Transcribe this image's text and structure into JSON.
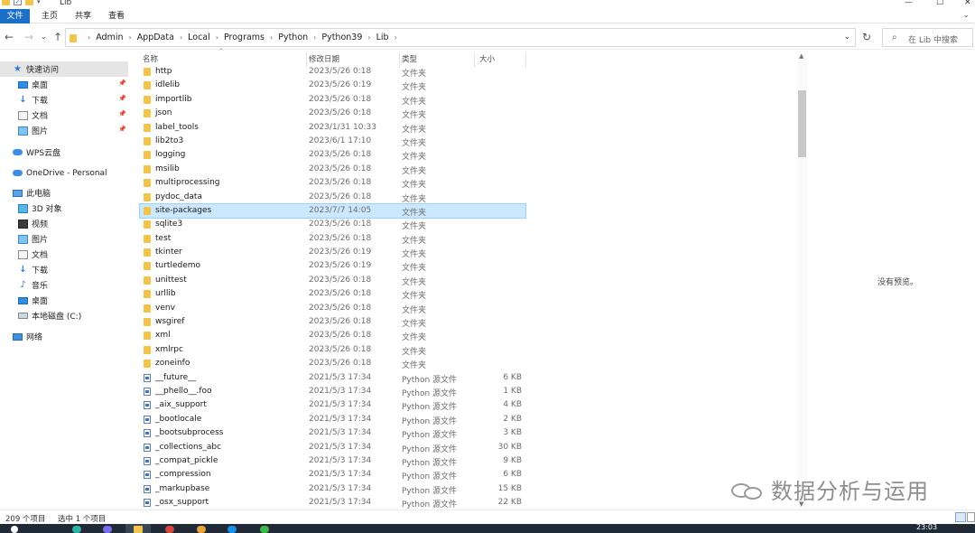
{
  "window": {
    "title": "Lib",
    "controls": [
      "—",
      "☐",
      "✕"
    ]
  },
  "ribbon": {
    "tabs": [
      "文件",
      "主页",
      "共享",
      "查看"
    ]
  },
  "address": {
    "crumbs": [
      "Admin",
      "AppData",
      "Local",
      "Programs",
      "Python",
      "Python39",
      "Lib"
    ],
    "search_placeholder": "在 Lib 中搜索"
  },
  "nav": {
    "items": [
      {
        "label": "快速访问",
        "icon": "star-icon",
        "selected": true
      },
      {
        "label": "桌面",
        "icon": "desktop-icon",
        "pinned": true
      },
      {
        "label": "下载",
        "icon": "download-icon",
        "pinned": true
      },
      {
        "label": "文档",
        "icon": "document-icon",
        "pinned": true
      },
      {
        "label": "图片",
        "icon": "picture-icon",
        "pinned": true
      },
      {
        "label": "WPS云盘",
        "icon": "cloud-icon"
      },
      {
        "label": "OneDrive - Personal",
        "icon": "cloud-icon"
      },
      {
        "label": "此电脑",
        "icon": "computer-icon"
      },
      {
        "label": "3D 对象",
        "icon": "3d-objects-icon"
      },
      {
        "label": "视频",
        "icon": "video-icon"
      },
      {
        "label": "图片",
        "icon": "picture-icon"
      },
      {
        "label": "文档",
        "icon": "document-icon"
      },
      {
        "label": "下载",
        "icon": "download-icon"
      },
      {
        "label": "音乐",
        "icon": "music-icon"
      },
      {
        "label": "桌面",
        "icon": "desktop-icon"
      },
      {
        "label": "本地磁盘 (C:)",
        "icon": "drive-icon"
      },
      {
        "label": "网络",
        "icon": "network-icon"
      }
    ]
  },
  "columns": {
    "name": "名称",
    "date": "修改日期",
    "type": "类型",
    "size": "大小"
  },
  "files": [
    {
      "name": "http",
      "date": "2023/5/26 0:18",
      "type": "文件夹",
      "size": "",
      "kind": "folder"
    },
    {
      "name": "idlelib",
      "date": "2023/5/26 0:19",
      "type": "文件夹",
      "size": "",
      "kind": "folder"
    },
    {
      "name": "importlib",
      "date": "2023/5/26 0:18",
      "type": "文件夹",
      "size": "",
      "kind": "folder"
    },
    {
      "name": "json",
      "date": "2023/5/26 0:18",
      "type": "文件夹",
      "size": "",
      "kind": "folder"
    },
    {
      "name": "label_tools",
      "date": "2023/1/31 10:33",
      "type": "文件夹",
      "size": "",
      "kind": "folder"
    },
    {
      "name": "lib2to3",
      "date": "2023/6/1 17:10",
      "type": "文件夹",
      "size": "",
      "kind": "folder"
    },
    {
      "name": "logging",
      "date": "2023/5/26 0:18",
      "type": "文件夹",
      "size": "",
      "kind": "folder"
    },
    {
      "name": "msilib",
      "date": "2023/5/26 0:18",
      "type": "文件夹",
      "size": "",
      "kind": "folder"
    },
    {
      "name": "multiprocessing",
      "date": "2023/5/26 0:18",
      "type": "文件夹",
      "size": "",
      "kind": "folder"
    },
    {
      "name": "pydoc_data",
      "date": "2023/5/26 0:18",
      "type": "文件夹",
      "size": "",
      "kind": "folder"
    },
    {
      "name": "site-packages",
      "date": "2023/7/7 14:05",
      "type": "文件夹",
      "size": "",
      "kind": "folder",
      "selected": true
    },
    {
      "name": "sqlite3",
      "date": "2023/5/26 0:18",
      "type": "文件夹",
      "size": "",
      "kind": "folder"
    },
    {
      "name": "test",
      "date": "2023/5/26 0:18",
      "type": "文件夹",
      "size": "",
      "kind": "folder"
    },
    {
      "name": "tkinter",
      "date": "2023/5/26 0:19",
      "type": "文件夹",
      "size": "",
      "kind": "folder"
    },
    {
      "name": "turtledemo",
      "date": "2023/5/26 0:19",
      "type": "文件夹",
      "size": "",
      "kind": "folder"
    },
    {
      "name": "unittest",
      "date": "2023/5/26 0:18",
      "type": "文件夹",
      "size": "",
      "kind": "folder"
    },
    {
      "name": "urllib",
      "date": "2023/5/26 0:18",
      "type": "文件夹",
      "size": "",
      "kind": "folder"
    },
    {
      "name": "venv",
      "date": "2023/5/26 0:18",
      "type": "文件夹",
      "size": "",
      "kind": "folder"
    },
    {
      "name": "wsgiref",
      "date": "2023/5/26 0:18",
      "type": "文件夹",
      "size": "",
      "kind": "folder"
    },
    {
      "name": "xml",
      "date": "2023/5/26 0:18",
      "type": "文件夹",
      "size": "",
      "kind": "folder"
    },
    {
      "name": "xmlrpc",
      "date": "2023/5/26 0:18",
      "type": "文件夹",
      "size": "",
      "kind": "folder"
    },
    {
      "name": "zoneinfo",
      "date": "2023/5/26 0:18",
      "type": "文件夹",
      "size": "",
      "kind": "folder"
    },
    {
      "name": "__future__",
      "date": "2021/5/3 17:34",
      "type": "Python 源文件",
      "size": "6 KB",
      "kind": "py"
    },
    {
      "name": "__phello__.foo",
      "date": "2021/5/3 17:34",
      "type": "Python 源文件",
      "size": "1 KB",
      "kind": "py"
    },
    {
      "name": "_aix_support",
      "date": "2021/5/3 17:34",
      "type": "Python 源文件",
      "size": "4 KB",
      "kind": "py"
    },
    {
      "name": "_bootlocale",
      "date": "2021/5/3 17:34",
      "type": "Python 源文件",
      "size": "2 KB",
      "kind": "py"
    },
    {
      "name": "_bootsubprocess",
      "date": "2021/5/3 17:34",
      "type": "Python 源文件",
      "size": "3 KB",
      "kind": "py"
    },
    {
      "name": "_collections_abc",
      "date": "2021/5/3 17:34",
      "type": "Python 源文件",
      "size": "30 KB",
      "kind": "py"
    },
    {
      "name": "_compat_pickle",
      "date": "2021/5/3 17:34",
      "type": "Python 源文件",
      "size": "9 KB",
      "kind": "py"
    },
    {
      "name": "_compression",
      "date": "2021/5/3 17:34",
      "type": "Python 源文件",
      "size": "6 KB",
      "kind": "py"
    },
    {
      "name": "_markupbase",
      "date": "2021/5/3 17:34",
      "type": "Python 源文件",
      "size": "15 KB",
      "kind": "py"
    },
    {
      "name": "_osx_support",
      "date": "2021/5/3 17:34",
      "type": "Python 源文件",
      "size": "22 KB",
      "kind": "py"
    }
  ],
  "preview": {
    "empty_text": "没有预览。"
  },
  "status": {
    "item_count": "209 个项目",
    "selection": "选中 1 个项目"
  },
  "watermark": {
    "text": "数据分析与运用"
  },
  "taskbar": {
    "time": "23:03"
  }
}
